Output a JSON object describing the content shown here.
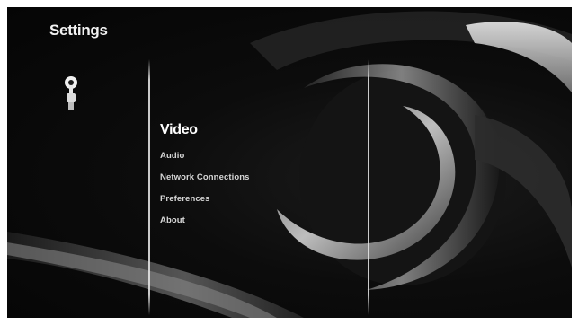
{
  "page": {
    "title": "Settings"
  },
  "menu": {
    "items": [
      {
        "label": "Video",
        "selected": true
      },
      {
        "label": "Audio",
        "selected": false
      },
      {
        "label": "Network Connections",
        "selected": false
      },
      {
        "label": "Preferences",
        "selected": false
      },
      {
        "label": "About",
        "selected": false
      }
    ]
  },
  "icons": {
    "settings": "wrench-screwdriver-icon"
  },
  "colors": {
    "background": "#0a0a0a",
    "text": "#eaeaea",
    "selected_text": "#ffffff",
    "frame": "#ffffff"
  }
}
